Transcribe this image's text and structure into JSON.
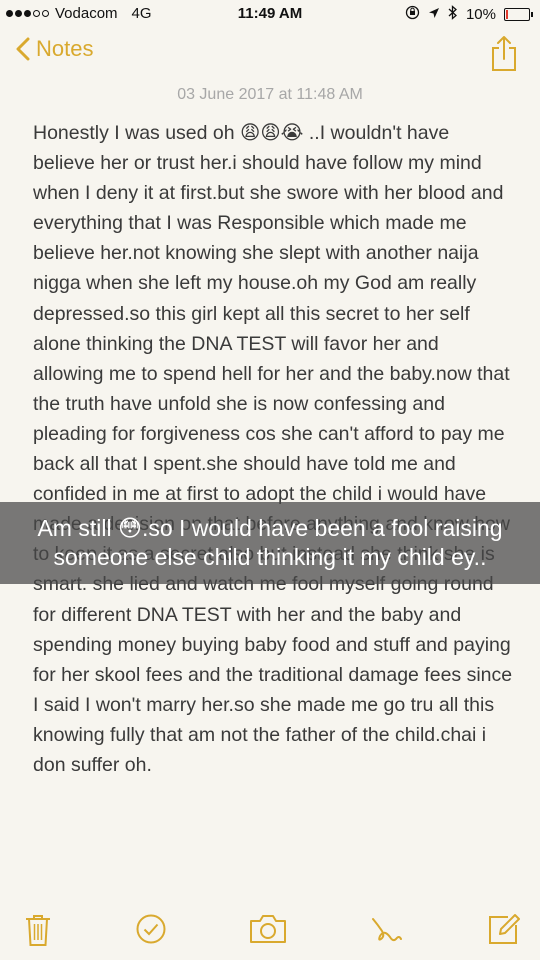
{
  "status": {
    "carrier": "Vodacom",
    "network": "4G",
    "time": "11:49 AM",
    "battery": "10%",
    "battery_level": 0.1
  },
  "nav": {
    "back_label": "Notes"
  },
  "note": {
    "date": "03 June 2017 at 11:48 AM",
    "text": "Honestly I was used oh 😩😩😭 ..I wouldn't have believe her or trust her.i should have follow my mind when I deny it at first.but she swore with her blood and everything that I was Responsible which made me believe her.not knowing she slept with  another naija nigga when she left my house.oh my God am really depressed.so this girl kept all this secret to her self alone thinking the DNA TEST will favor her and allowing me to spend hell for her and the baby.now that the truth have unfold she is now confessing and pleading for forgiveness cos she can't afford to pay me back all that I spent.she should have told me and confided in me at first to adopt the child i would have made a decision on that before anything and know how to keep it as a secret also but instead she think she is smart. she lied and watch me fool myself going round for different DNA TEST with her and the baby and spending money buying baby food and stuff and paying for her skool fees and the traditional damage fees since I said I won't marry her.so she made me go tru all this knowing fully that am not the father of the child.chai i don suffer oh."
  },
  "caption": "Am still 😳.so I would have been a fool raising someone else child thinking it my child ey..",
  "toolbar": {
    "icons": [
      "trash-icon",
      "checkmark-icon",
      "camera-icon",
      "sketch-icon",
      "compose-icon"
    ]
  }
}
